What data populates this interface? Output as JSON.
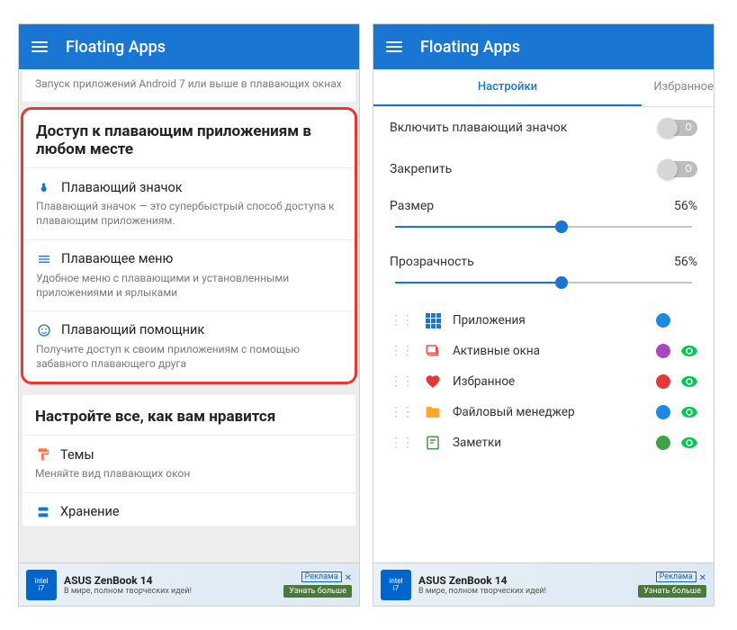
{
  "app_title": "Floating Apps",
  "left": {
    "snippet": "Запуск приложений Android 7 или выше в плавающих окнах",
    "highlight_title": "Доступ к плавающим приложениям в любом месте",
    "items": [
      {
        "title": "Плавающий значок",
        "desc": "Плавающий значок — это супербыстрый способ доступа к плавающим приложениям."
      },
      {
        "title": "Плавающее меню",
        "desc": "Удобное меню с плавающими и установленными приложениями и ярлыками"
      },
      {
        "title": "Плавающий помощник",
        "desc": "Получите доступ к своим приложениям с помощью забавного плавающего друга"
      }
    ],
    "section2_title": "Настройте все, как вам нравится",
    "themes": {
      "title": "Темы",
      "desc": "Меняйте вид плавающих окон"
    },
    "storage_title": "Хранение"
  },
  "right": {
    "tabs": {
      "settings": "Настройки",
      "favorites": "Избранное"
    },
    "enable_icon": "Включить плавающий значок",
    "pin": "Закрепить",
    "size": {
      "label": "Размер",
      "value": "56%"
    },
    "opacity": {
      "label": "Прозрачность",
      "value": "56%"
    },
    "toggle_off": "O",
    "list": [
      {
        "label": "Приложения",
        "color": "#1e88e5"
      },
      {
        "label": "Активные окна",
        "color": "#ab47bc"
      },
      {
        "label": "Избранное",
        "color": "#e53935"
      },
      {
        "label": "Файловый менеджер",
        "color": "#1e88e5"
      },
      {
        "label": "Заметки",
        "color": "#43a047"
      }
    ]
  },
  "ad": {
    "title": "ASUS ZenBook 14",
    "subtitle": "В мире, полном творческих идей!",
    "tag": "Реклама",
    "close": "✕",
    "button": "Узнать больше"
  }
}
